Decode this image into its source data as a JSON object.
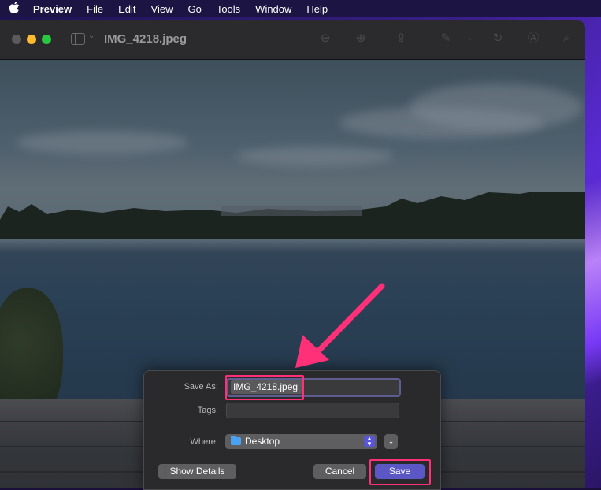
{
  "menubar": {
    "app_name": "Preview",
    "items": [
      "File",
      "Edit",
      "View",
      "Go",
      "Tools",
      "Window",
      "Help"
    ]
  },
  "window": {
    "title": "IMG_4218.jpeg"
  },
  "save_dialog": {
    "save_as_label": "Save As:",
    "save_as_value": "IMG_4218.jpeg",
    "tags_label": "Tags:",
    "tags_value": "",
    "where_label": "Where:",
    "where_value": "Desktop",
    "show_details_label": "Show Details",
    "cancel_label": "Cancel",
    "save_label": "Save"
  },
  "colors": {
    "highlight": "#ff2f78",
    "accent": "#5b57c4",
    "folder": "#4aa3f0"
  },
  "icons": {
    "toolbar": [
      "zoom-out-icon",
      "zoom-in-icon",
      "share-icon",
      "markup-icon",
      "rotate-icon",
      "annotate-icon",
      "search-icon"
    ]
  }
}
